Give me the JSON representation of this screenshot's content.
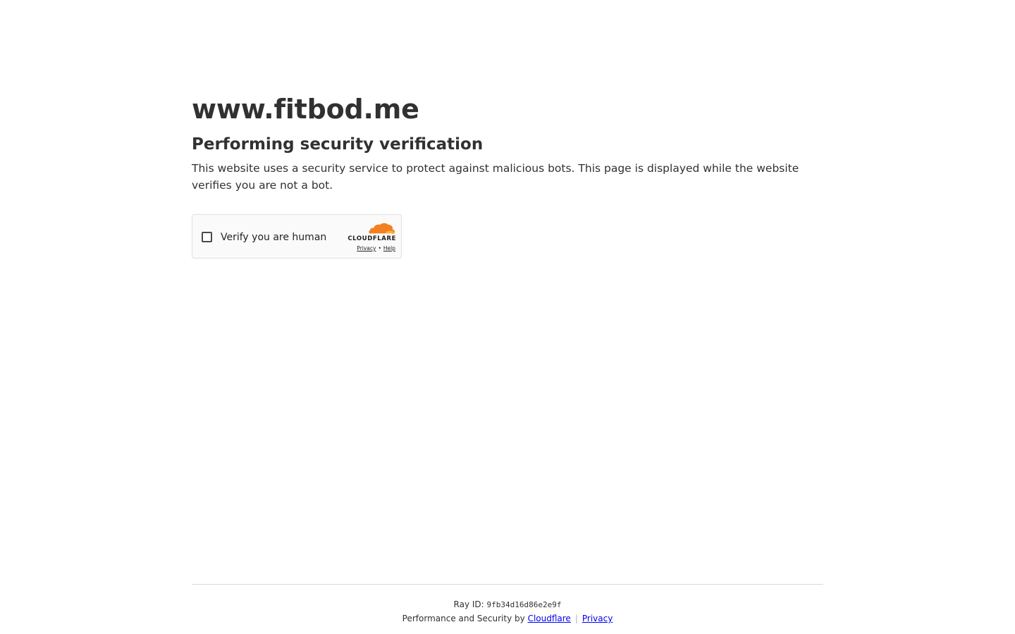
{
  "site": {
    "title": "www.fitbod.me"
  },
  "verification": {
    "heading": "Performing security verification",
    "description": "This website uses a security service to protect against malicious bots. This page is displayed while the website verifies you are not a bot."
  },
  "widget": {
    "checkbox_label": "Verify you are human",
    "brand": "CLOUDFLARE",
    "privacy_link": "Privacy",
    "separator": "•",
    "help_link": "Help",
    "brand_color": "#f38020"
  },
  "footer": {
    "ray_label": "Ray ID:",
    "ray_id": "9fb34d16d86e2e9f",
    "perf_text": "Performance and Security by",
    "cloudflare_link": "Cloudflare",
    "separator": "|",
    "privacy_link": "Privacy"
  }
}
